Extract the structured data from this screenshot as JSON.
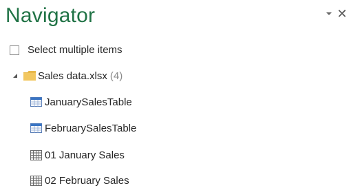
{
  "navigator": {
    "title": "Navigator",
    "select_multiple_label": "Select multiple items",
    "root": {
      "name": "Sales data.xlsx",
      "count": "(4)",
      "icon": "folder-icon"
    },
    "items": [
      {
        "label": "JanuarySalesTable",
        "icon": "table-icon"
      },
      {
        "label": "FebruarySalesTable",
        "icon": "table-icon"
      },
      {
        "label": "01 January Sales",
        "icon": "sheet-icon"
      },
      {
        "label": "02 February Sales",
        "icon": "sheet-icon"
      }
    ],
    "colors": {
      "title": "#217346",
      "folder": "#e8b84a",
      "table_header": "#3a75c4"
    }
  }
}
